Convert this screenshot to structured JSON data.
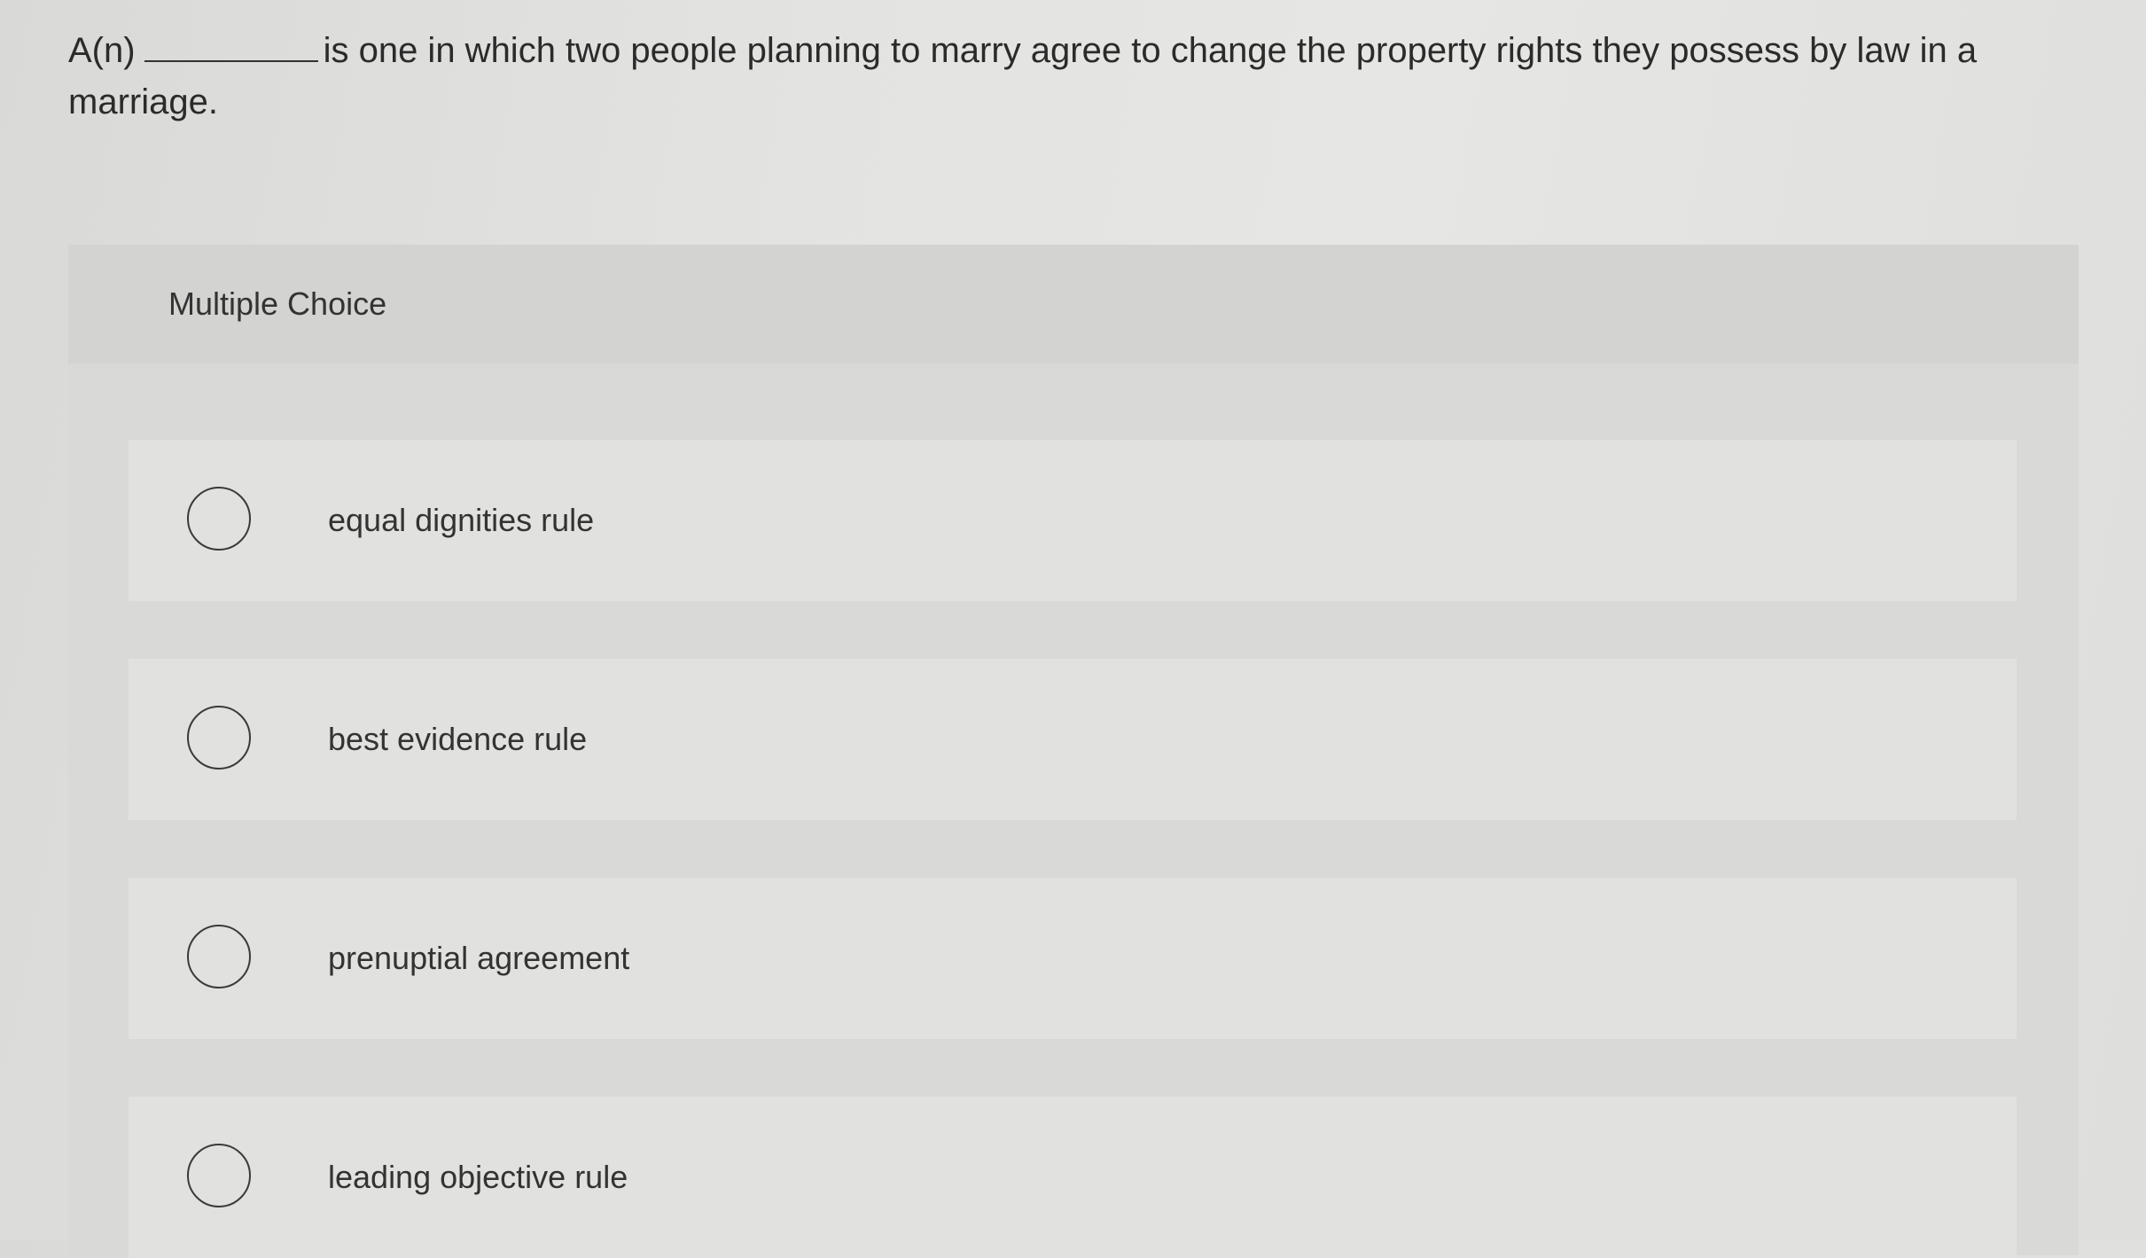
{
  "question": {
    "prefix": "A(n)",
    "text": "is one in which two people planning to marry agree to change the property rights they possess by law in a marriage."
  },
  "panel": {
    "title": "Multiple Choice",
    "options": [
      {
        "label": "equal dignities rule",
        "selected": false
      },
      {
        "label": "best evidence rule",
        "selected": false
      },
      {
        "label": "prenuptial agreement",
        "selected": false
      },
      {
        "label": "leading objective rule",
        "selected": false
      }
    ]
  }
}
